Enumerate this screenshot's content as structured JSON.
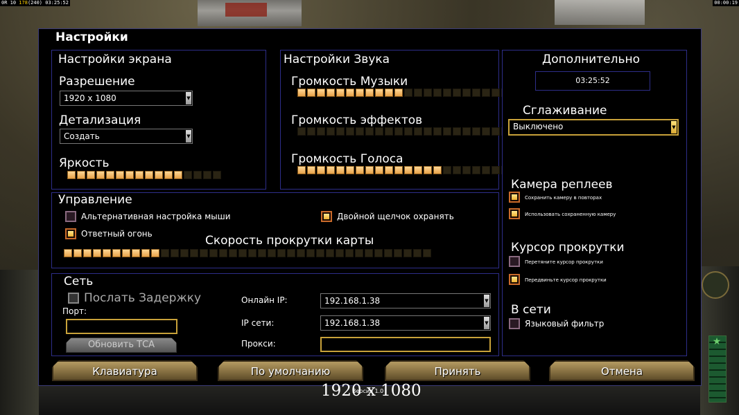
{
  "hud": {
    "top_left_prefix": "0R 10",
    "top_left_mid": "178",
    "top_left_bracket": "(240)",
    "top_left_time": "03:25:52",
    "top_right_time": "00:00:19"
  },
  "dialog": {
    "title": "Настройки",
    "screen": {
      "title": "Настройки экрана",
      "resolution_label": "Разрешение",
      "resolution_value": "1920 x 1080",
      "detail_label": "Детализация",
      "detail_value": "Создать",
      "brightness_label": "Яркость",
      "brightness_level": 12,
      "brightness_total": 16
    },
    "sound": {
      "title": "Настройки Звука",
      "music_label": "Громкость Музыки",
      "music_level": 11,
      "music_total": 22,
      "effects_label": "Громкость эффектов",
      "effects_level": 0,
      "effects_total": 22,
      "voice_label": "Громкость Голоса",
      "voice_level": 15,
      "voice_total": 22
    },
    "control": {
      "title": "Управление",
      "alt_mouse_label": "Альтернативная настройка мыши",
      "double_click_label": "Двойной щелчок охранять",
      "return_fire_label": "Ответный огонь",
      "scroll_speed_label": "Скорость прокрутки карты",
      "scroll_level": 10,
      "scroll_total": 38
    },
    "network": {
      "title": "Сеть",
      "send_delay_label": "Послать Задержку",
      "port_label": "Порт:",
      "update_button": "Обновить ТСА",
      "online_ip_label": "Онлайн IP:",
      "online_ip_value": "192.168.1.38",
      "network_ip_label": "IP сети:",
      "network_ip_value": "192.168.1.38",
      "proxy_label": "Прокси:"
    },
    "extra": {
      "title": "Дополнительно",
      "time": "03:25:52",
      "antialias_label": "Сглаживание",
      "antialias_value": "Выключено",
      "replay_camera_title": "Камера реплеев",
      "save_camera_label": "Сохранить камеру в повторах",
      "use_saved_camera_label": "Использовать сохраненную камеру",
      "scroll_cursor_title": "Курсор прокрутки",
      "drag_cursor_label": "Перетяните курсор прокрутки",
      "move_cursor_label": "Передвиньте курсор прокрутки",
      "online_title": "В сети",
      "language_filter_label": "Языковый фильтр"
    },
    "buttons": {
      "keyboard": "Клавиатура",
      "default": "По умолчанию",
      "accept": "Принять",
      "cancel": "Отмена"
    }
  },
  "footer": {
    "resolution_overlay": "1920 x 1080",
    "version_text": "Версия 1.0"
  }
}
